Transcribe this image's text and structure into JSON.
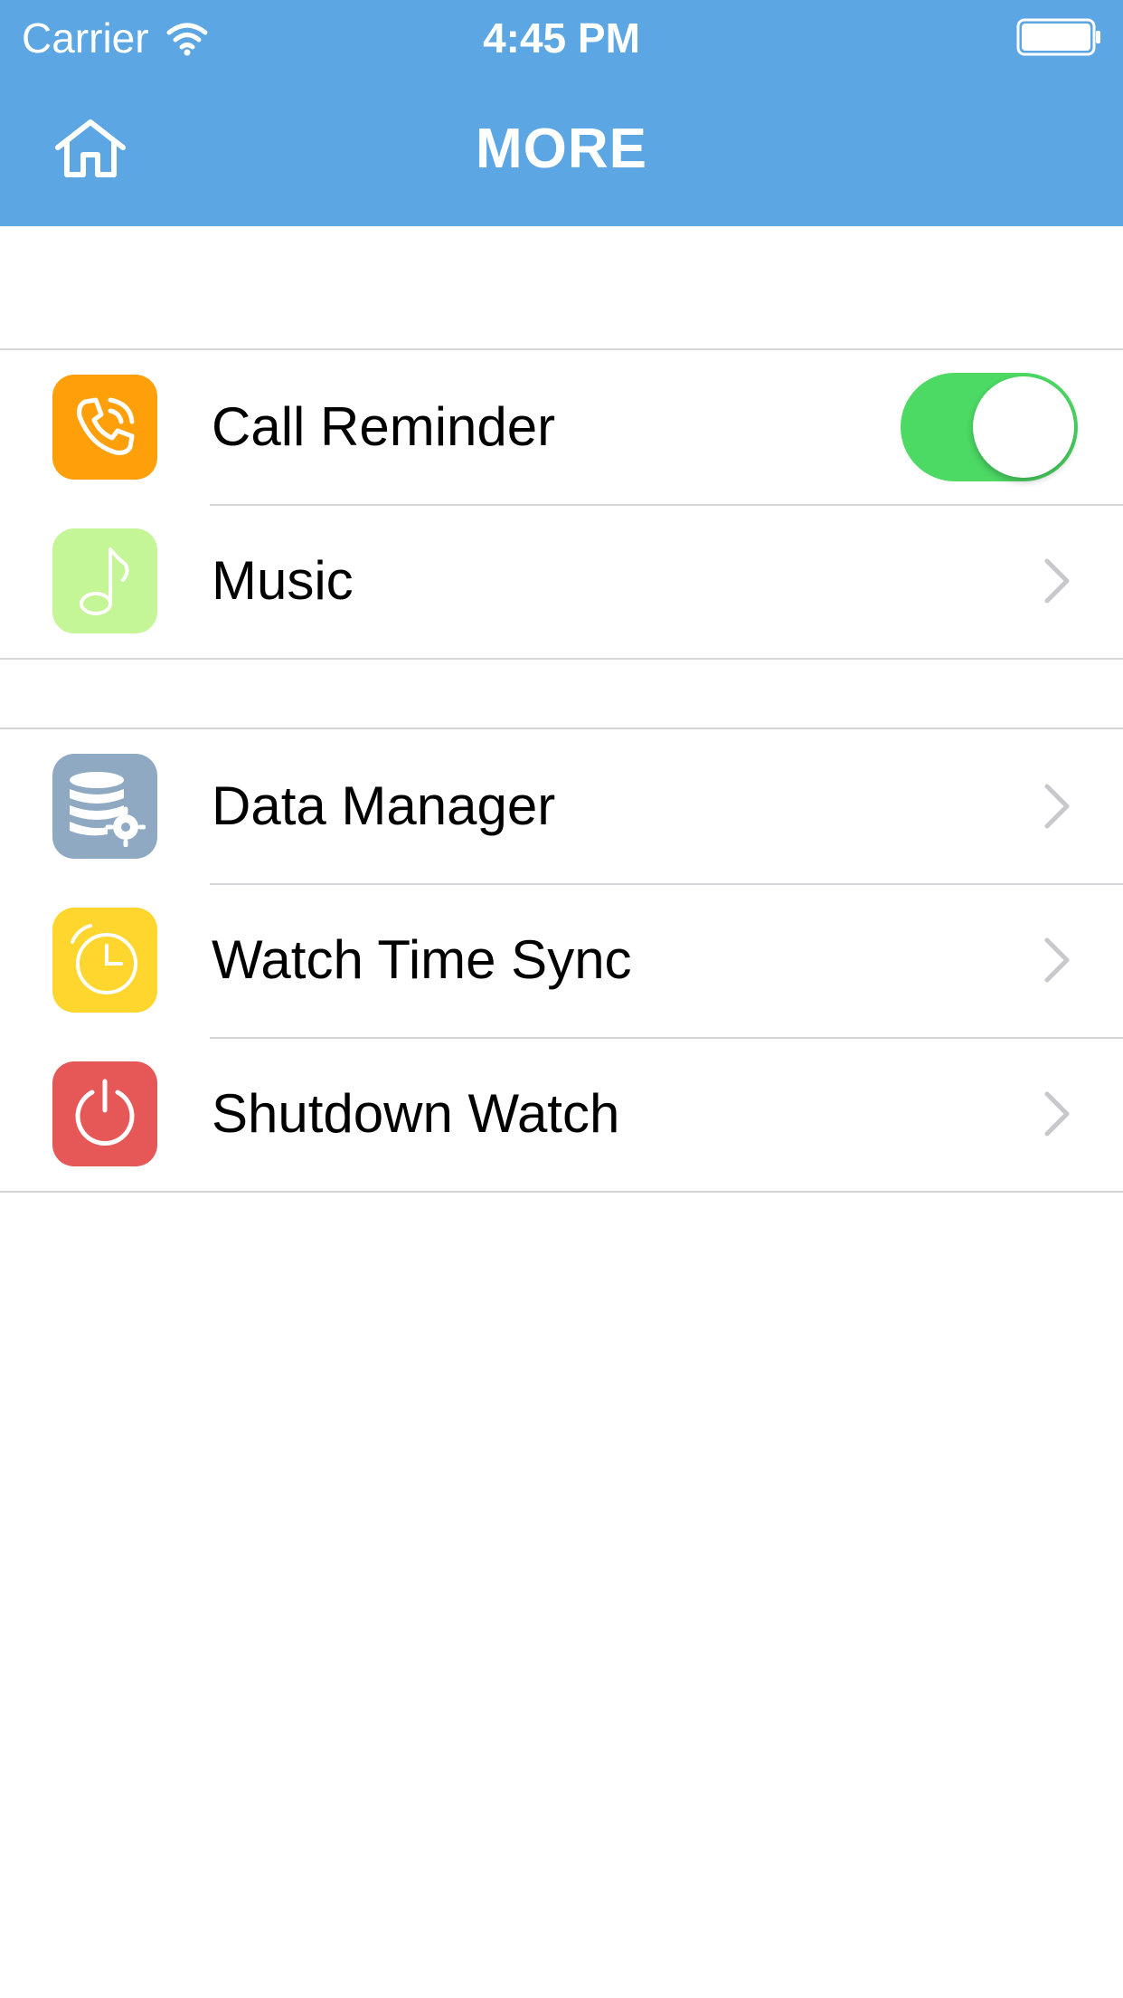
{
  "status_bar": {
    "carrier": "Carrier",
    "time": "4:45 PM"
  },
  "nav": {
    "title": "MORE",
    "home_icon": "home-icon"
  },
  "colors": {
    "header": "#5BA6E3",
    "toggle_on": "#4CD964",
    "call_icon_bg": "#FFA00A",
    "music_icon_bg": "#C4F596",
    "data_icon_bg": "#8FA9C2",
    "sync_icon_bg": "#FFD62E",
    "shutdown_icon_bg": "#E65757"
  },
  "groups": [
    {
      "items": [
        {
          "label": "Call Reminder",
          "icon": "phone-icon",
          "accessory": "toggle",
          "toggle_on": true
        },
        {
          "label": "Music",
          "icon": "music-note-icon",
          "accessory": "chevron"
        }
      ]
    },
    {
      "items": [
        {
          "label": "Data Manager",
          "icon": "database-settings-icon",
          "accessory": "chevron"
        },
        {
          "label": "Watch Time Sync",
          "icon": "alarm-clock-icon",
          "accessory": "chevron"
        },
        {
          "label": "Shutdown Watch",
          "icon": "power-icon",
          "accessory": "chevron"
        }
      ]
    }
  ]
}
